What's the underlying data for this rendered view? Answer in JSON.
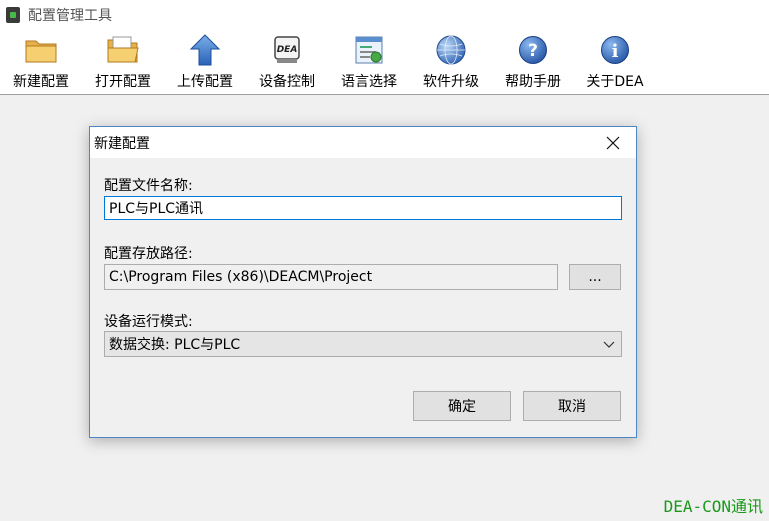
{
  "window": {
    "title": "配置管理工具"
  },
  "toolbar": {
    "items": [
      {
        "label": "新建配置",
        "icon": "folder-icon"
      },
      {
        "label": "打开配置",
        "icon": "open-folder-icon"
      },
      {
        "label": "上传配置",
        "icon": "upload-arrow-icon"
      },
      {
        "label": "设备控制",
        "icon": "device-control-icon"
      },
      {
        "label": "语言选择",
        "icon": "language-icon"
      },
      {
        "label": "软件升级",
        "icon": "globe-icon"
      },
      {
        "label": "帮助手册",
        "icon": "help-icon"
      },
      {
        "label": "关于DEA",
        "icon": "info-icon"
      }
    ],
    "device_icon_text": "DEA"
  },
  "dialog": {
    "title": "新建配置",
    "name_label": "配置文件名称:",
    "name_value": "PLC与PLC通讯",
    "path_label": "配置存放路径:",
    "path_value": "C:\\Program Files (x86)\\DEACM\\Project",
    "browse_label": "...",
    "mode_label": "设备运行模式:",
    "mode_value": "数据交换: PLC与PLC",
    "ok_label": "确定",
    "cancel_label": "取消"
  },
  "watermark": "DEA-CON通讯",
  "colors": {
    "accent": "#0078d7",
    "dialog_border": "#4a86c8",
    "watermark": "#1a9a1a"
  }
}
